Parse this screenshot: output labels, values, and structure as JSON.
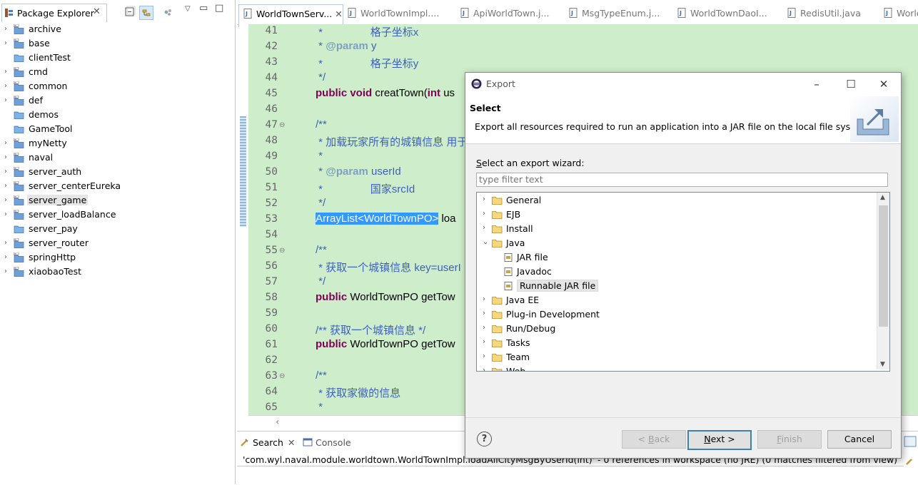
{
  "package_explorer": {
    "title": "Package Explorer",
    "projects": [
      {
        "name": "archive",
        "expandable": true
      },
      {
        "name": "base",
        "expandable": true
      },
      {
        "name": "clientTest",
        "expandable": false
      },
      {
        "name": "cmd",
        "expandable": true
      },
      {
        "name": "common",
        "expandable": true
      },
      {
        "name": "def",
        "expandable": true
      },
      {
        "name": "demos",
        "expandable": false
      },
      {
        "name": "GameTool",
        "expandable": false
      },
      {
        "name": "myNetty",
        "expandable": true
      },
      {
        "name": "naval",
        "expandable": true
      },
      {
        "name": "server_auth",
        "expandable": true
      },
      {
        "name": "server_centerEureka",
        "expandable": true
      },
      {
        "name": "server_game",
        "expandable": true,
        "selected": true
      },
      {
        "name": "server_loadBalance",
        "expandable": true
      },
      {
        "name": "server_pay",
        "expandable": false
      },
      {
        "name": "server_router",
        "expandable": true
      },
      {
        "name": "springHttp",
        "expandable": true
      },
      {
        "name": "xiaobaoTest",
        "expandable": true
      }
    ]
  },
  "editor": {
    "tabs": [
      {
        "label": "WorldTownServ...",
        "active": true
      },
      {
        "label": "WorldTownImpl...."
      },
      {
        "label": "ApiWorldTown.j..."
      },
      {
        "label": "MsgTypeEnum.j..."
      },
      {
        "label": "WorldTownDaoI..."
      },
      {
        "label": "RedisUtil.java"
      },
      {
        "label": "World"
      }
    ],
    "lines": [
      {
        "n": "41",
        "l41": "     *              格子坐标x"
      },
      {
        "n": "42"
      },
      {
        "n": "43",
        "l43": "     *              格子坐标y"
      },
      {
        "n": "44",
        "l44": "     */"
      },
      {
        "n": "45"
      },
      {
        "n": "46"
      },
      {
        "n": "47",
        "fold": true
      },
      {
        "n": "48"
      },
      {
        "n": "49"
      },
      {
        "n": "50"
      },
      {
        "n": "51",
        "l51": "国家srcId"
      },
      {
        "n": "52"
      },
      {
        "n": "53"
      },
      {
        "n": "54"
      },
      {
        "n": "55",
        "fold": true
      },
      {
        "n": "56"
      },
      {
        "n": "57"
      },
      {
        "n": "58"
      },
      {
        "n": "59"
      },
      {
        "n": "60"
      },
      {
        "n": "61"
      },
      {
        "n": "62"
      },
      {
        "n": "63",
        "fold": true
      },
      {
        "n": "64"
      },
      {
        "n": "65"
      }
    ],
    "code": {
      "l41_star": "*",
      "l41_text": "格子坐标x",
      "l42_star": "* ",
      "l42_tag": "@param",
      "l42_text": " y",
      "l43_star": "*",
      "l43_text": "格子坐标y",
      "l44": "*/",
      "l45_kw": "public void",
      "l45_text": " creatTown(",
      "l45_kw2": "int",
      "l45_text2": " us",
      "l47": "/**",
      "l48": "* 加载玩家所有的城镇信息 用于",
      "l49": "*",
      "l50_star": "* ",
      "l50_tag": "@param",
      "l50_text": " userId",
      "l51_star": "*",
      "l51_text": "国家srcId",
      "l52": "*/",
      "l53_sel": "ArrayList<WorldTownPO>",
      "l53_text": " loa",
      "l55": "/**",
      "l56": "* 获取一个城镇信息 key=userI",
      "l57": "*/",
      "l58_kw": "public",
      "l58_text": " WorldTownPO getTow",
      "l60": "/** 获取一个城镇信息 */",
      "l61_kw": "public",
      "l61_text": " WorldTownPO getTow",
      "l63": "/**",
      "l64": "* 获取家徽的信息",
      "l65": "*"
    }
  },
  "bottom_panel": {
    "tabs": [
      {
        "label": "Search",
        "active": true
      },
      {
        "label": "Console"
      }
    ],
    "result": "'com.wyl.naval.module.worldtown.WorldTownImpl.loadAllCityMsgByUserId(int)' - 0 references in workspace (no JRE) (0 matches filtered from view)"
  },
  "dialog": {
    "title": "Export",
    "header_title": "Select",
    "header_desc": "Export all resources required to run an application into a JAR file on the local file system.",
    "wizard_label": "Select an export wizard:",
    "filter_placeholder": "type filter text",
    "tree": [
      {
        "label": "General",
        "level": 0,
        "expanded": false
      },
      {
        "label": "EJB",
        "level": 0,
        "expanded": false
      },
      {
        "label": "Install",
        "level": 0,
        "expanded": false
      },
      {
        "label": "Java",
        "level": 0,
        "expanded": true
      },
      {
        "label": "JAR file",
        "level": 1
      },
      {
        "label": "Javadoc",
        "level": 1
      },
      {
        "label": "Runnable JAR file",
        "level": 1,
        "selected": true
      },
      {
        "label": "Java EE",
        "level": 0,
        "expanded": false
      },
      {
        "label": "Plug-in Development",
        "level": 0,
        "expanded": false
      },
      {
        "label": "Run/Debug",
        "level": 0,
        "expanded": false
      },
      {
        "label": "Tasks",
        "level": 0,
        "expanded": false
      },
      {
        "label": "Team",
        "level": 0,
        "expanded": false
      },
      {
        "label": "Web",
        "level": 0,
        "expanded": false
      }
    ],
    "buttons": {
      "back": "< Back",
      "next": "Next >",
      "finish": "Finish",
      "cancel": "Cancel"
    }
  },
  "colors": {
    "code_bg": "#ceeecb",
    "keyword": "#7f0055",
    "javadoc": "#3f5fbf",
    "selection": "#3399ff"
  }
}
